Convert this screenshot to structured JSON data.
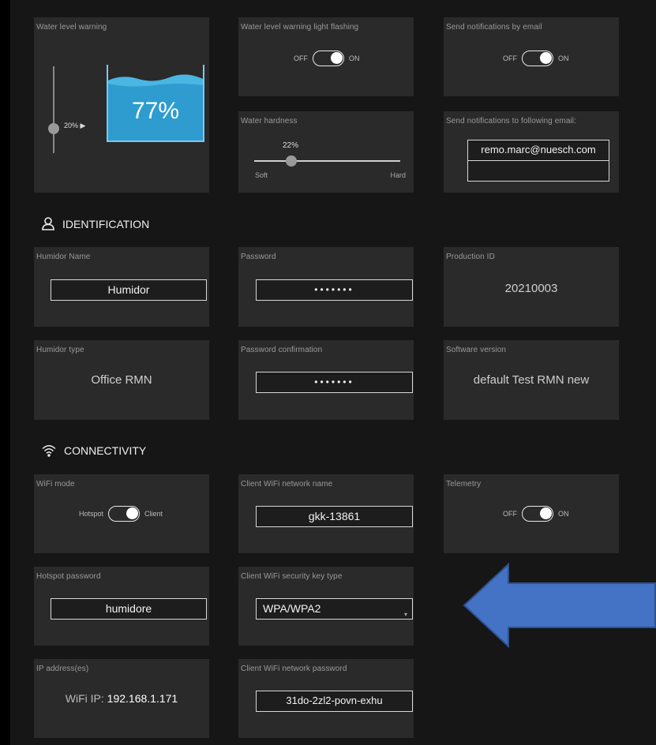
{
  "water_level": {
    "label": "Water level warning",
    "threshold": "20%",
    "percent_text": "77%",
    "fill_fraction": 0.77,
    "slider_fraction": 0.2
  },
  "warning_light": {
    "label": "Water level warning light flashing",
    "off": "OFF",
    "on": "ON",
    "state": "on"
  },
  "email_notify": {
    "label": "Send notifications by email",
    "off": "OFF",
    "on": "ON",
    "state": "on"
  },
  "water_hardness": {
    "label": "Water hardness",
    "value": "22%",
    "fraction": 0.22,
    "min_label": "Soft",
    "max_label": "Hard"
  },
  "email_list": {
    "label": "Send notifications to following email:",
    "email1": "remo.marc@nuesch.com",
    "email2": ""
  },
  "identification": {
    "title": "IDENTIFICATION",
    "humidor_name_label": "Humidor Name",
    "humidor_name": "Humidor",
    "password_label": "Password",
    "password": "•••••••",
    "production_id_label": "Production ID",
    "production_id": "20210003",
    "humidor_type_label": "Humidor type",
    "humidor_type": "Office RMN",
    "password_confirm_label": "Password confirmation",
    "password_confirm": "•••••••",
    "software_version_label": "Software version",
    "software_version": "default Test RMN new"
  },
  "connectivity": {
    "title": "CONNECTIVITY",
    "wifi_mode_label": "WiFi mode",
    "wifi_mode_left": "Hotspot",
    "wifi_mode_right": "Client",
    "client_network_label": "Client WiFi network name",
    "client_network": "gkk-13861",
    "telemetry_label": "Telemetry",
    "telemetry_off": "OFF",
    "telemetry_on": "ON",
    "hotspot_password_label": "Hotspot password",
    "hotspot_password": "humidore",
    "security_type_label": "Client WiFi security key type",
    "security_type": "WPA/WPA2",
    "ip_label": "IP address(es)",
    "ip_prefix": "WiFi IP:",
    "ip_value": "192.168.1.171",
    "client_password_label": "Client WiFi network password",
    "client_password": "31do-2zl2-povn-exhu"
  },
  "colors": {
    "water": "#2e9ccf",
    "arrow": "#4472c4",
    "card": "#2a2a2a"
  }
}
